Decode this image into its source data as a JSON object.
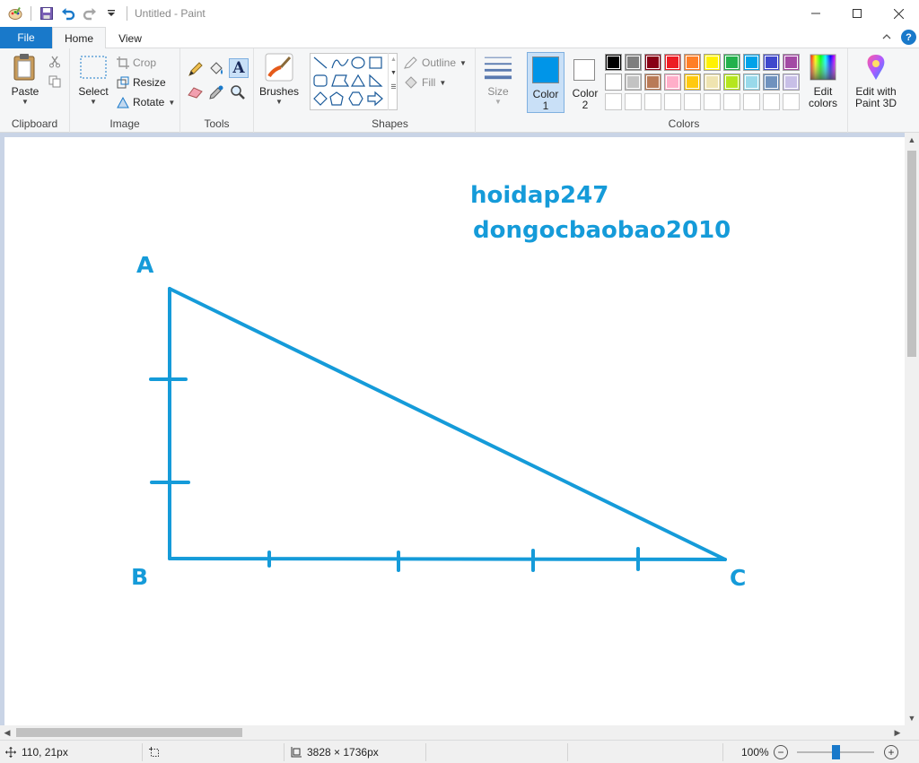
{
  "titlebar": {
    "title": "Untitled - Paint"
  },
  "tabs": {
    "file": "File",
    "home": "Home",
    "view": "View"
  },
  "ribbon": {
    "clipboard": {
      "paste": "Paste",
      "group": "Clipboard"
    },
    "image": {
      "select": "Select",
      "crop": "Crop",
      "resize": "Resize",
      "rotate": "Rotate",
      "group": "Image"
    },
    "tools": {
      "group": "Tools"
    },
    "brushes": {
      "label": "Brushes"
    },
    "shapes": {
      "outline": "Outline",
      "fill": "Fill",
      "group": "Shapes"
    },
    "size": {
      "label": "Size"
    },
    "colors": {
      "color1_line1": "Color",
      "color1_line2": "1",
      "color2_line1": "Color",
      "color2_line2": "2",
      "edit_colors_line1": "Edit",
      "edit_colors_line2": "colors",
      "edit3d_line1": "Edit with",
      "edit3d_line2": "Paint 3D",
      "group": "Colors",
      "color1_value": "#0095e8",
      "color2_value": "#ffffff",
      "palette_row1": [
        "#000000",
        "#7f7f7f",
        "#880015",
        "#ed1c24",
        "#ff7f27",
        "#fff200",
        "#22b14c",
        "#00a2e8",
        "#3f48cc",
        "#a349a4"
      ],
      "palette_row2": [
        "#ffffff",
        "#c3c3c3",
        "#b97a57",
        "#ffaec9",
        "#ffc90e",
        "#efe4b0",
        "#b5e61d",
        "#99d9ea",
        "#7092be",
        "#c8bfe7"
      ]
    }
  },
  "canvas": {
    "text_line1": "hoidap247",
    "text_line2": "dongocbaobao2010",
    "vertex_a": "A",
    "vertex_b": "B",
    "vertex_c": "C",
    "stroke_color": "#159bd9"
  },
  "status": {
    "cursor_pos": "110, 21px",
    "image_size": "3828 × 1736px",
    "zoom": "100%"
  }
}
